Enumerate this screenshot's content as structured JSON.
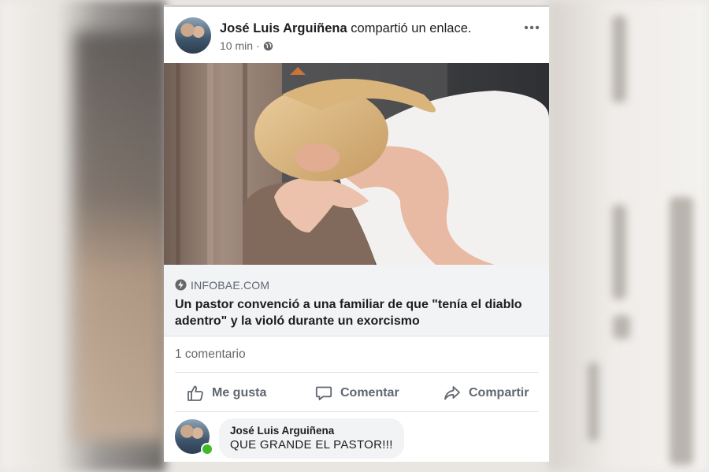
{
  "post": {
    "author": "José Luis Arguiñena",
    "action": "compartió un enlace.",
    "time": "10 min",
    "separator": "·",
    "audience_icon": "globe-icon",
    "menu_icon": "more-options-icon"
  },
  "link": {
    "domain": "INFOBAE.COM",
    "title": "Un pastor convenció a una familiar de que \"tenía el diablo adentro\" y la violó durante un exorcismo"
  },
  "stats": {
    "comments": "1 comentario"
  },
  "actions": {
    "like": "Me gusta",
    "comment": "Comentar",
    "share": "Compartir"
  },
  "comment": {
    "author": "José Luis Arguiñena",
    "text": "QUE GRANDE EL PASTOR!!!",
    "online_color": "#42b72a"
  },
  "colors": {
    "text_primary": "#1c1e21",
    "text_secondary": "#606770",
    "link_box_bg": "#f2f3f5"
  }
}
